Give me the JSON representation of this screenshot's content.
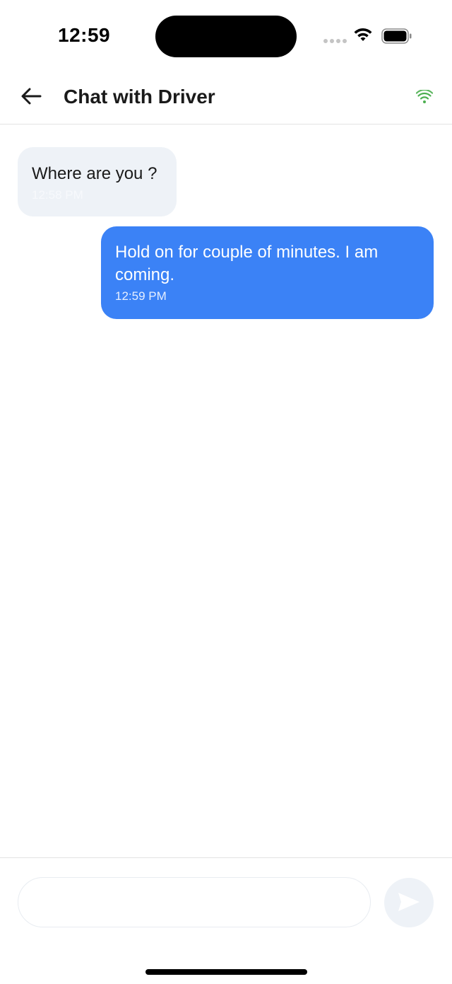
{
  "status_bar": {
    "time": "12:59"
  },
  "header": {
    "title": "Chat with Driver",
    "back_icon": "arrow-left-icon",
    "connection_icon": "wifi-icon",
    "connection_color": "#4caf50"
  },
  "messages": [
    {
      "direction": "incoming",
      "text": "Where are you ?",
      "time": "12:58 PM"
    },
    {
      "direction": "outgoing",
      "text": "Hold on for couple of minutes. I am coming.",
      "time": "12:59 PM"
    }
  ],
  "composer": {
    "input_value": "",
    "send_icon": "send-icon"
  },
  "colors": {
    "outgoing_bubble": "#3b82f6",
    "incoming_bubble": "#eef2f7"
  }
}
